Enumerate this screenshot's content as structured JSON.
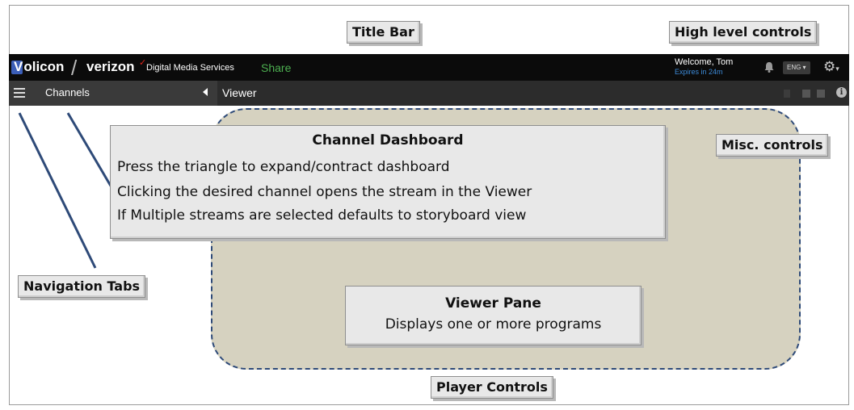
{
  "callouts": {
    "title_bar": "Title Bar",
    "high_level_controls": "High level controls",
    "misc_controls": "Misc. controls",
    "navigation_tabs": "Navigation Tabs",
    "player_controls": "Player Controls"
  },
  "titlebar": {
    "brand_volicon": "olicon",
    "brand_v": "V",
    "brand_verizon": "verizon",
    "product": "Digital Media Services",
    "share": "Share",
    "welcome": "Welcome, Tom",
    "expires": "Expires in 24m",
    "language": "ENG ▾",
    "icons": [
      "bell-icon",
      "gear-icon"
    ]
  },
  "navbar": {
    "channels": "Channels",
    "viewer": "Viewer",
    "icons": [
      "hamburger-icon",
      "collapse-triangle-icon",
      "grid-icon",
      "layout-icon",
      "info-icon"
    ]
  },
  "channel_dashboard": {
    "title": "Channel Dashboard",
    "lines": [
      "Press the triangle to expand/contract dashboard",
      "Clicking the desired channel opens the stream in the Viewer",
      "If Multiple streams are selected defaults to storyboard view"
    ]
  },
  "viewer_pane": {
    "title": "Viewer Pane",
    "description": "Displays one or more programs"
  },
  "colors": {
    "titlebar_bg": "#0b0b0b",
    "navbar_bg": "#2c2c2c",
    "share_green": "#4caf50",
    "expires_blue": "#3d8bd9",
    "viewer_pane_fill": "#d6d2c0",
    "dash_border": "#2e4a78",
    "verizon_red": "#e2231a"
  }
}
